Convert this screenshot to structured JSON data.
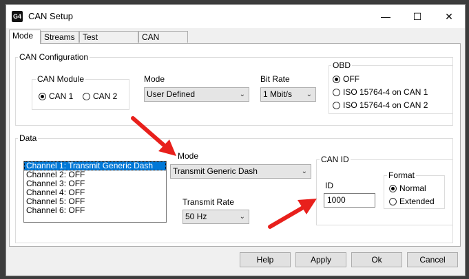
{
  "window": {
    "title": "CAN Setup",
    "icon_text": "G4",
    "minimize": "—",
    "maximize": "☐",
    "close": "✕"
  },
  "tabs": [
    {
      "label": "Mode",
      "active": true
    },
    {
      "label": "Streams",
      "active": false
    },
    {
      "label": "Test Calculator",
      "active": false
    },
    {
      "label": "CAN Devices",
      "active": false
    }
  ],
  "can_config": {
    "title": "CAN Configuration",
    "can_module": {
      "title": "CAN Module",
      "options": [
        "CAN 1",
        "CAN 2"
      ],
      "selected": "CAN 1"
    },
    "mode": {
      "label": "Mode",
      "value": "User Defined"
    },
    "bit_rate": {
      "label": "Bit Rate",
      "value": "1 Mbit/s"
    },
    "obd": {
      "title": "OBD",
      "options": [
        "OFF",
        "ISO 15764-4 on CAN 1",
        "ISO 15764-4 on CAN 2"
      ],
      "selected": "OFF"
    }
  },
  "data": {
    "title": "Data",
    "channels": [
      "Channel 1: Transmit Generic Dash",
      "Channel 2: OFF",
      "Channel 3: OFF",
      "Channel 4: OFF",
      "Channel 5: OFF",
      "Channel 6: OFF"
    ],
    "selected_channel_index": 0,
    "mode": {
      "label": "Mode",
      "value": "Transmit Generic Dash"
    },
    "transmit_rate": {
      "label": "Transmit Rate",
      "value": "50 Hz"
    },
    "can_id": {
      "title": "CAN ID",
      "id_label": "ID",
      "id_value": "1000",
      "format": {
        "title": "Format",
        "options": [
          "Normal",
          "Extended"
        ],
        "selected": "Normal"
      }
    }
  },
  "buttons": {
    "help": "Help",
    "apply": "Apply",
    "ok": "Ok",
    "cancel": "Cancel"
  },
  "colors": {
    "accent": "#0078d7",
    "annotation_arrow": "#e8201c"
  },
  "icons": {
    "dropdown": "chevron-down-icon"
  }
}
